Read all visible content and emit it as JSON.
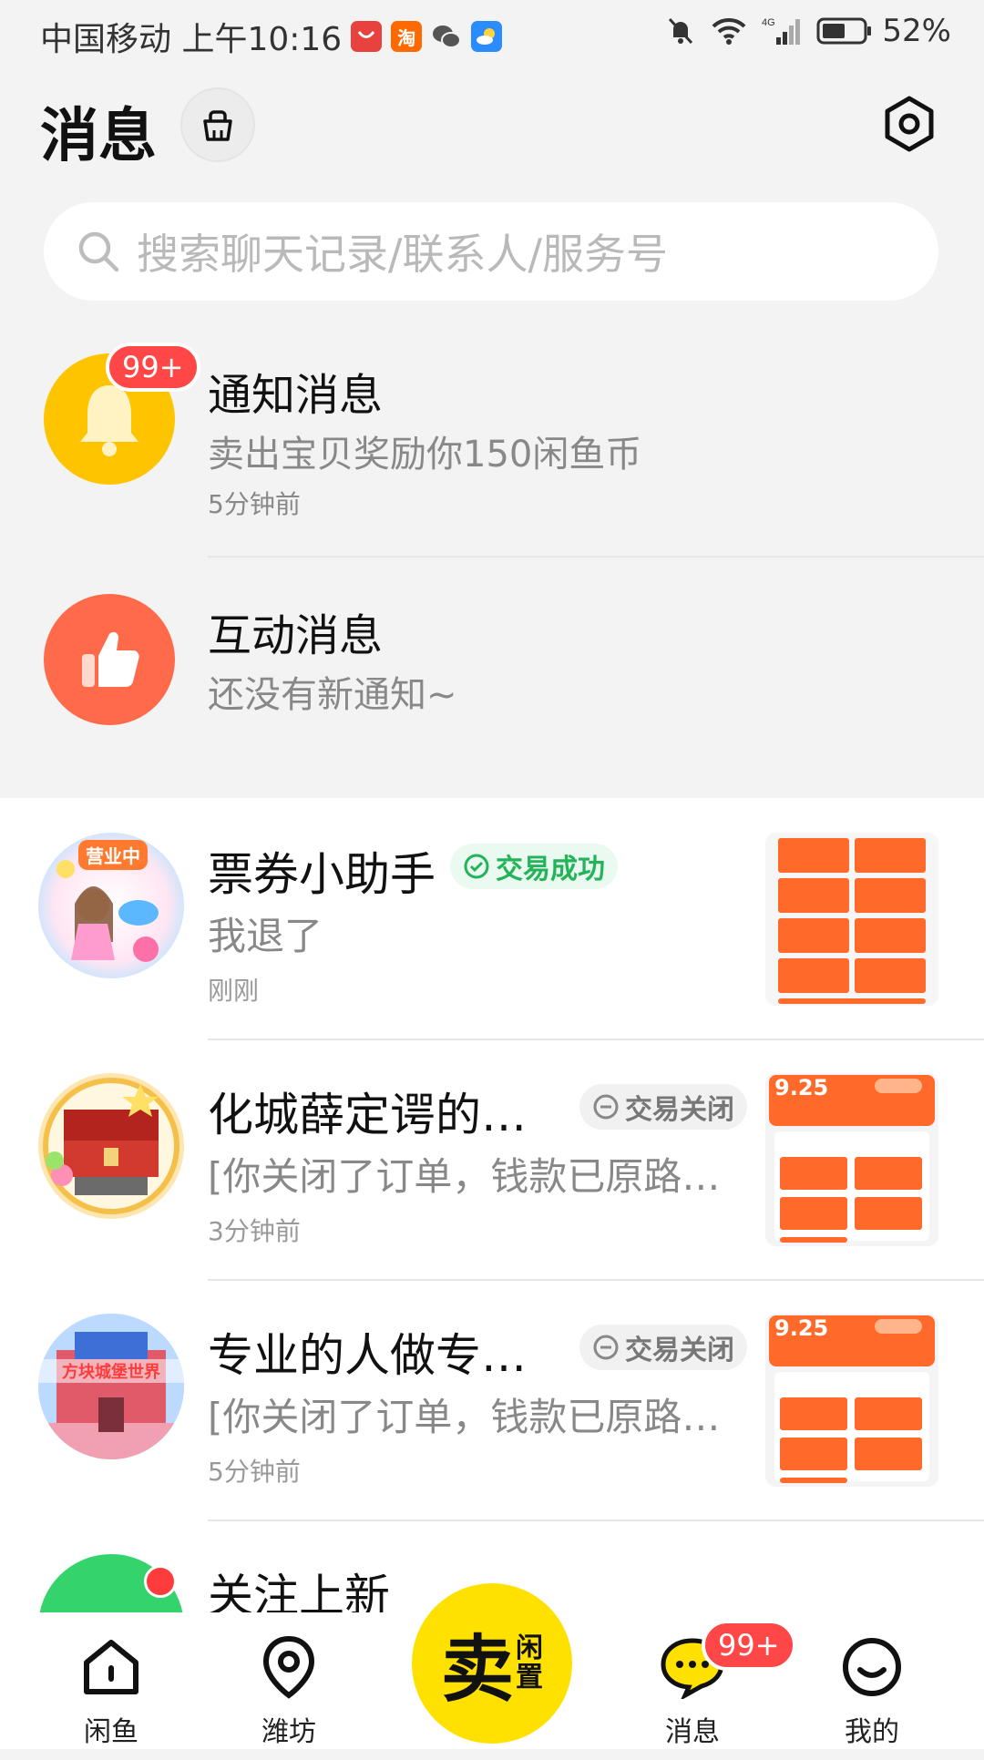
{
  "status_bar": {
    "carrier_time": "中国移动 上午10:16",
    "app_icons": [
      {
        "icon": "huawei-appgallery-icon",
        "label": "",
        "color": "#e8423f"
      },
      {
        "icon": "taobao-flash-icon",
        "label": "淘",
        "color": "#ff6a00"
      },
      {
        "icon": "wechat-icon",
        "label": "",
        "color": "#555555"
      },
      {
        "icon": "weather-icon",
        "label": "",
        "color": "#2b8cff"
      }
    ],
    "battery": "52%"
  },
  "header": {
    "title": "消息"
  },
  "search": {
    "placeholder": "搜索聊天记录/联系人/服务号"
  },
  "system_rows": [
    {
      "title": "通知消息",
      "subtitle": "卖出宝贝奖励你150闲鱼币",
      "time": "5分钟前",
      "badge": "99+",
      "color": "#ffc400"
    },
    {
      "title": "互动消息",
      "subtitle": "还没有新通知~",
      "time": "",
      "badge": "",
      "color": "#ff6a4a"
    }
  ],
  "chats": [
    {
      "name": "票券小助手",
      "tag": "交易成功",
      "tag_type": "success",
      "message": "我退了",
      "time": "刚刚"
    },
    {
      "name": "化城薛定谔的…",
      "tag": "交易关闭",
      "tag_type": "closed",
      "message": "[你关闭了订单，钱款已原路…",
      "time": "3分钟前",
      "thumb_price": "9.25"
    },
    {
      "name": "专业的人做专…",
      "tag": "交易关闭",
      "tag_type": "closed",
      "message": "[你关闭了订单，钱款已原路…",
      "time": "5分钟前",
      "thumb_price": "9.25"
    },
    {
      "name": "关注上新",
      "tag": "",
      "message": "",
      "time": ""
    }
  ],
  "avatar_texts": {
    "chat0": "营业中",
    "chat2": "方块城堡世界"
  },
  "bottom_nav": {
    "items": [
      {
        "label": "闲鱼",
        "icon": "home-icon"
      },
      {
        "label": "潍坊",
        "icon": "location-icon"
      },
      {
        "label": "消息",
        "icon": "message-icon"
      },
      {
        "label": "我的",
        "icon": "profile-icon"
      }
    ],
    "sell_big": "卖",
    "sell_small_1": "闲",
    "sell_small_2": "置",
    "message_badge": "99+"
  },
  "colors": {
    "accent_yellow": "#ffe100",
    "badge_red": "#ff4747",
    "success_green": "#23b45a",
    "thumb_orange": "#ff6a2a"
  }
}
